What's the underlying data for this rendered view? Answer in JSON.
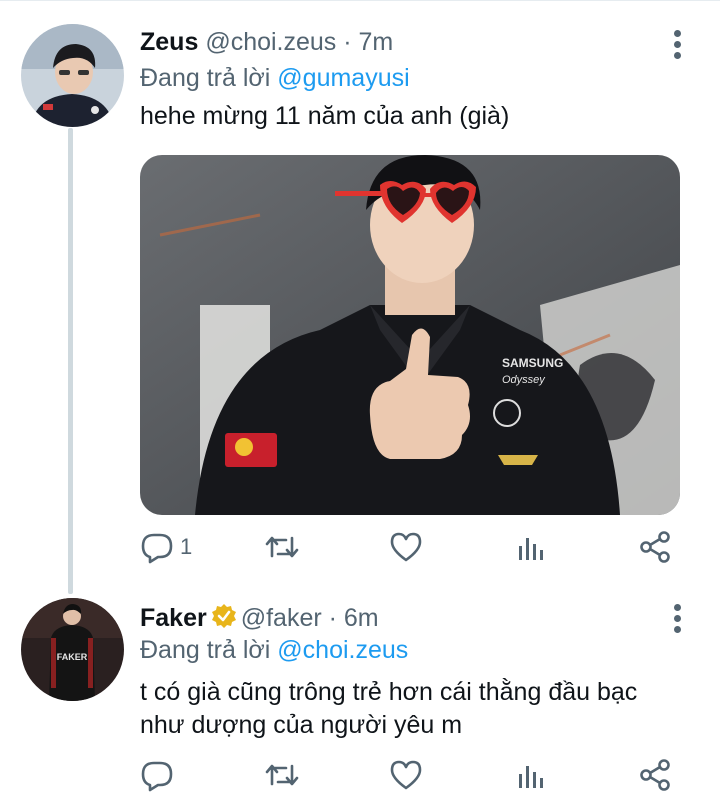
{
  "tweets": [
    {
      "name": "Zeus",
      "handle": "@choi.zeus",
      "sep": " · ",
      "time": "7m",
      "reply_prefix": "Đang trả lời ",
      "reply_to": "@gumayusi",
      "text": "hehe mừng 11 năm của anh (già)",
      "reply_count": "1",
      "has_media": true,
      "verified": false
    },
    {
      "name": "Faker",
      "handle": "@faker",
      "sep": " · ",
      "time": "6m",
      "reply_prefix": "Đang trả lời ",
      "reply_to": "@choi.zeus",
      "text": "t có già cũng trông trẻ hơn cái thằng đầu bạc như dượng của người yêu m",
      "reply_count": "",
      "has_media": false,
      "verified": true
    }
  ],
  "media_text": {
    "sponsor": "SAMSUNG",
    "sponsor_sub": "Odyssey",
    "jacket_name": "FAKER"
  },
  "icons": [
    "reply-icon",
    "retweet-icon",
    "like-icon",
    "views-icon",
    "share-icon",
    "more-icon",
    "verified-icon"
  ],
  "colors": {
    "accent": "#1d9bf0",
    "muted": "#536471",
    "verified": "#e8b51b"
  }
}
